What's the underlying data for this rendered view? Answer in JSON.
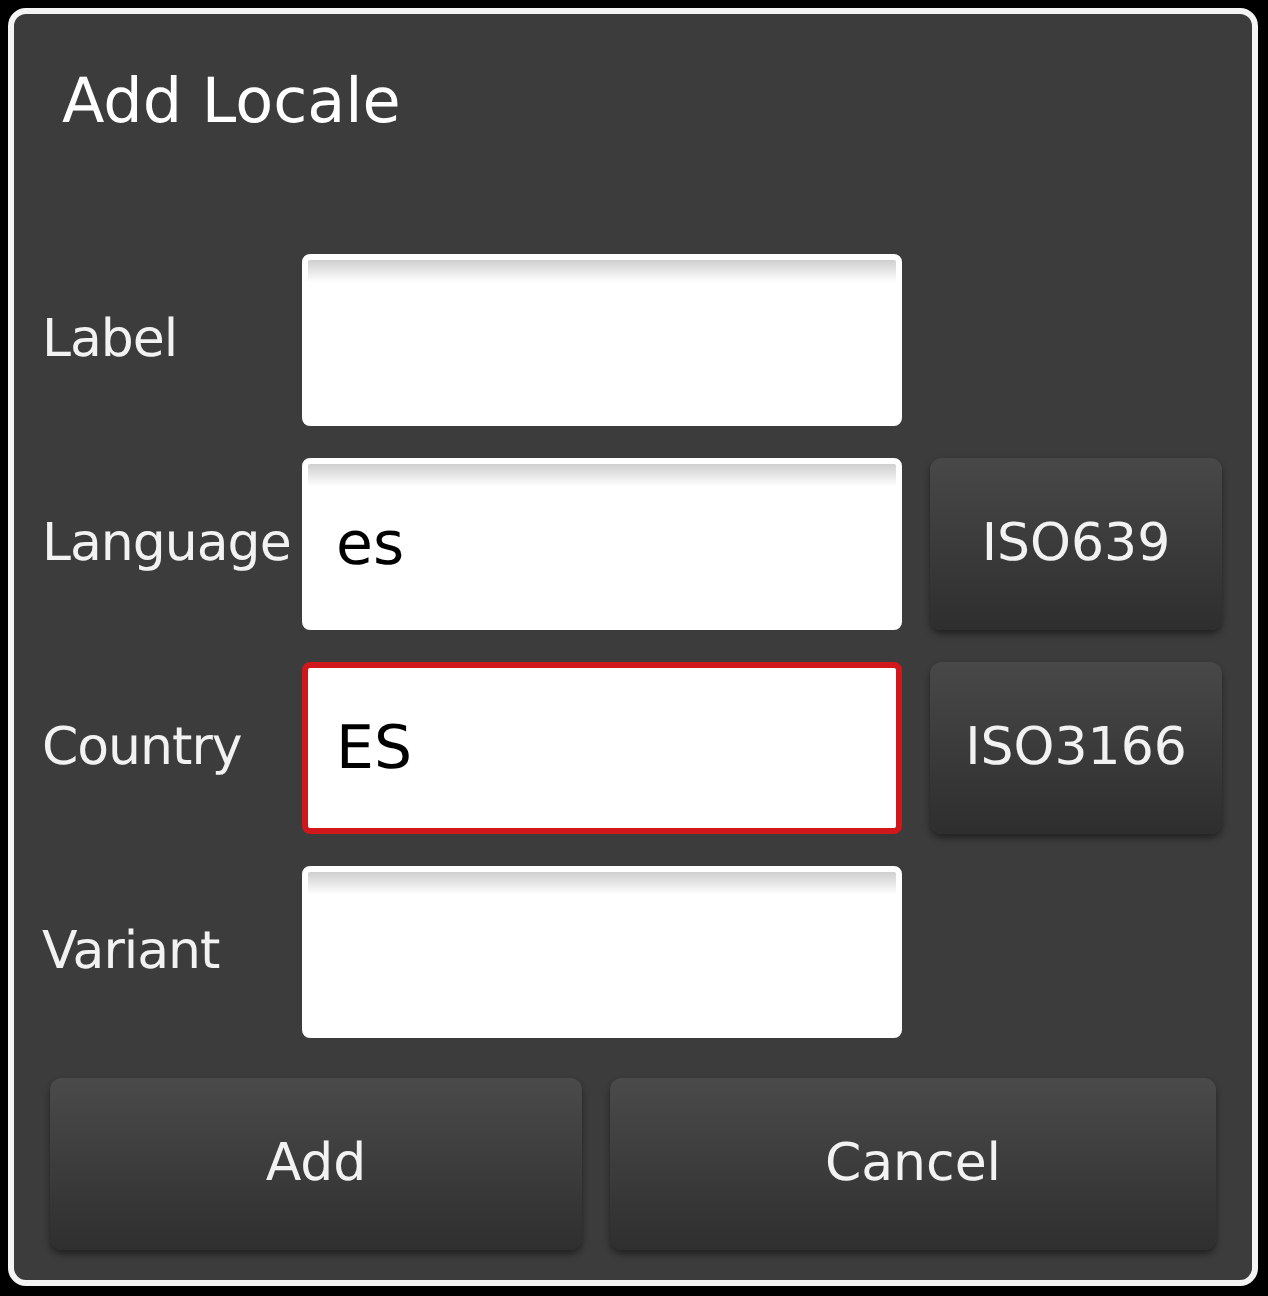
{
  "dialog": {
    "title": "Add Locale"
  },
  "fields": [
    {
      "label": "Label",
      "focused": false
    },
    {
      "label": "Language",
      "value": "es",
      "focused": false,
      "button": "ISO639"
    },
    {
      "label": "Country",
      "value": "ES",
      "focused": true,
      "button": "ISO3166"
    },
    {
      "label": "Variant",
      "focused": false
    }
  ],
  "buttons": [
    "Add",
    "Cancel"
  ]
}
